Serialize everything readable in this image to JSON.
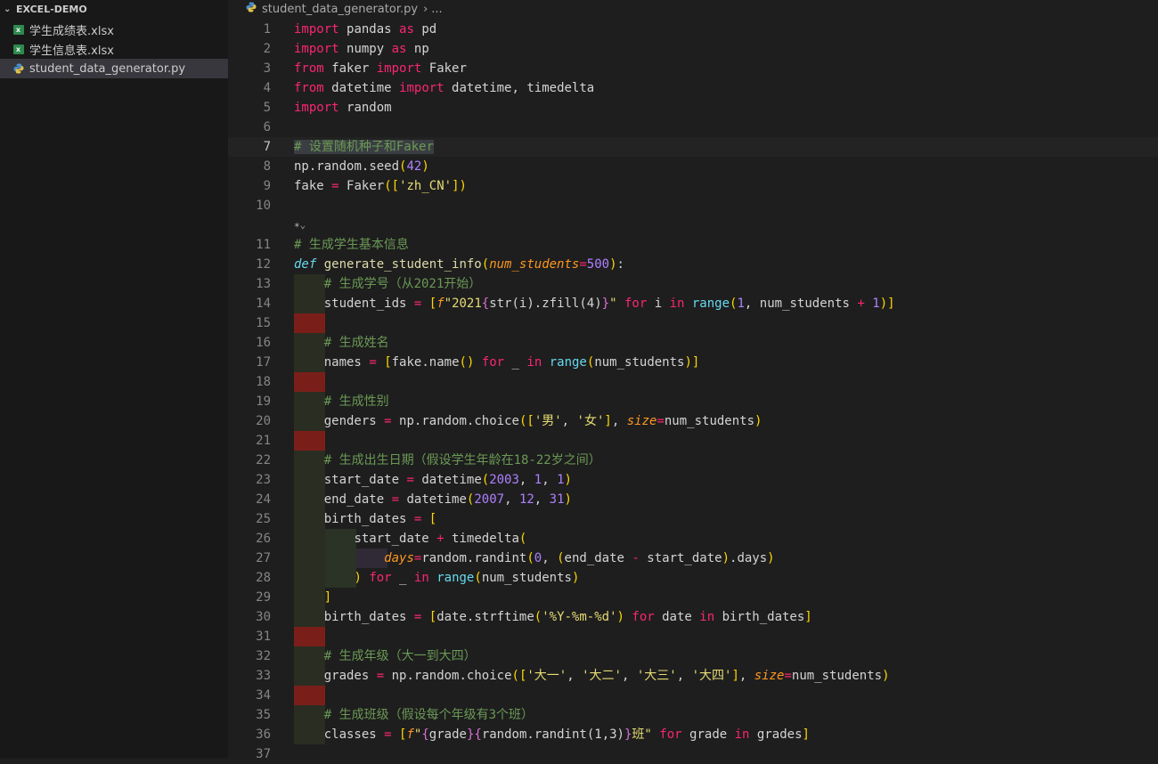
{
  "explorer": {
    "section_title": "EXCEL-DEMO",
    "files": [
      {
        "name": "学生成绩表.xlsx",
        "type": "excel"
      },
      {
        "name": "学生信息表.xlsx",
        "type": "excel"
      },
      {
        "name": "student_data_generator.py",
        "type": "python",
        "active": true
      }
    ]
  },
  "editor": {
    "breadcrumb_file": "student_data_generator.py",
    "breadcrumb_more": "...",
    "current_line": 7,
    "codelens_icon": "sparkle-icon",
    "lines": [
      "import pandas as pd",
      "import numpy as np",
      "from faker import Faker",
      "from datetime import datetime, timedelta",
      "import random",
      "",
      "# 设置随机种子和Faker",
      "np.random.seed(42)",
      "fake = Faker(['zh_CN'])",
      "",
      "# 生成学生基本信息",
      "def generate_student_info(num_students=500):",
      "    # 生成学号（从2021开始）",
      "    student_ids = [f\"2021{str(i).zfill(4)}\" for i in range(1, num_students + 1)]",
      "",
      "    # 生成姓名",
      "    names = [fake.name() for _ in range(num_students)]",
      "",
      "    # 生成性别",
      "    genders = np.random.choice(['男', '女'], size=num_students)",
      "",
      "    # 生成出生日期（假设学生年龄在18-22岁之间）",
      "    start_date = datetime(2003, 1, 1)",
      "    end_date = datetime(2007, 12, 31)",
      "    birth_dates = [",
      "        start_date + timedelta(",
      "            days=random.randint(0, (end_date - start_date).days)",
      "        ) for _ in range(num_students)",
      "    ]",
      "    birth_dates = [date.strftime('%Y-%m-%d') for date in birth_dates]",
      "",
      "    # 生成年级（大一到大四）",
      "    grades = np.random.choice(['大一', '大二', '大三', '大四'], size=num_students)",
      "",
      "    # 生成班级（假设每个年级有3个班）",
      "    classes = [f\"{grade}{random.randint(1,3)}班\" for grade in grades]",
      ""
    ]
  },
  "colors": {
    "sidebar_bg": "#181818",
    "editor_bg": "#1e1e1e",
    "active_file_bg": "#37373d",
    "error_marker": "#7a1e1a"
  }
}
